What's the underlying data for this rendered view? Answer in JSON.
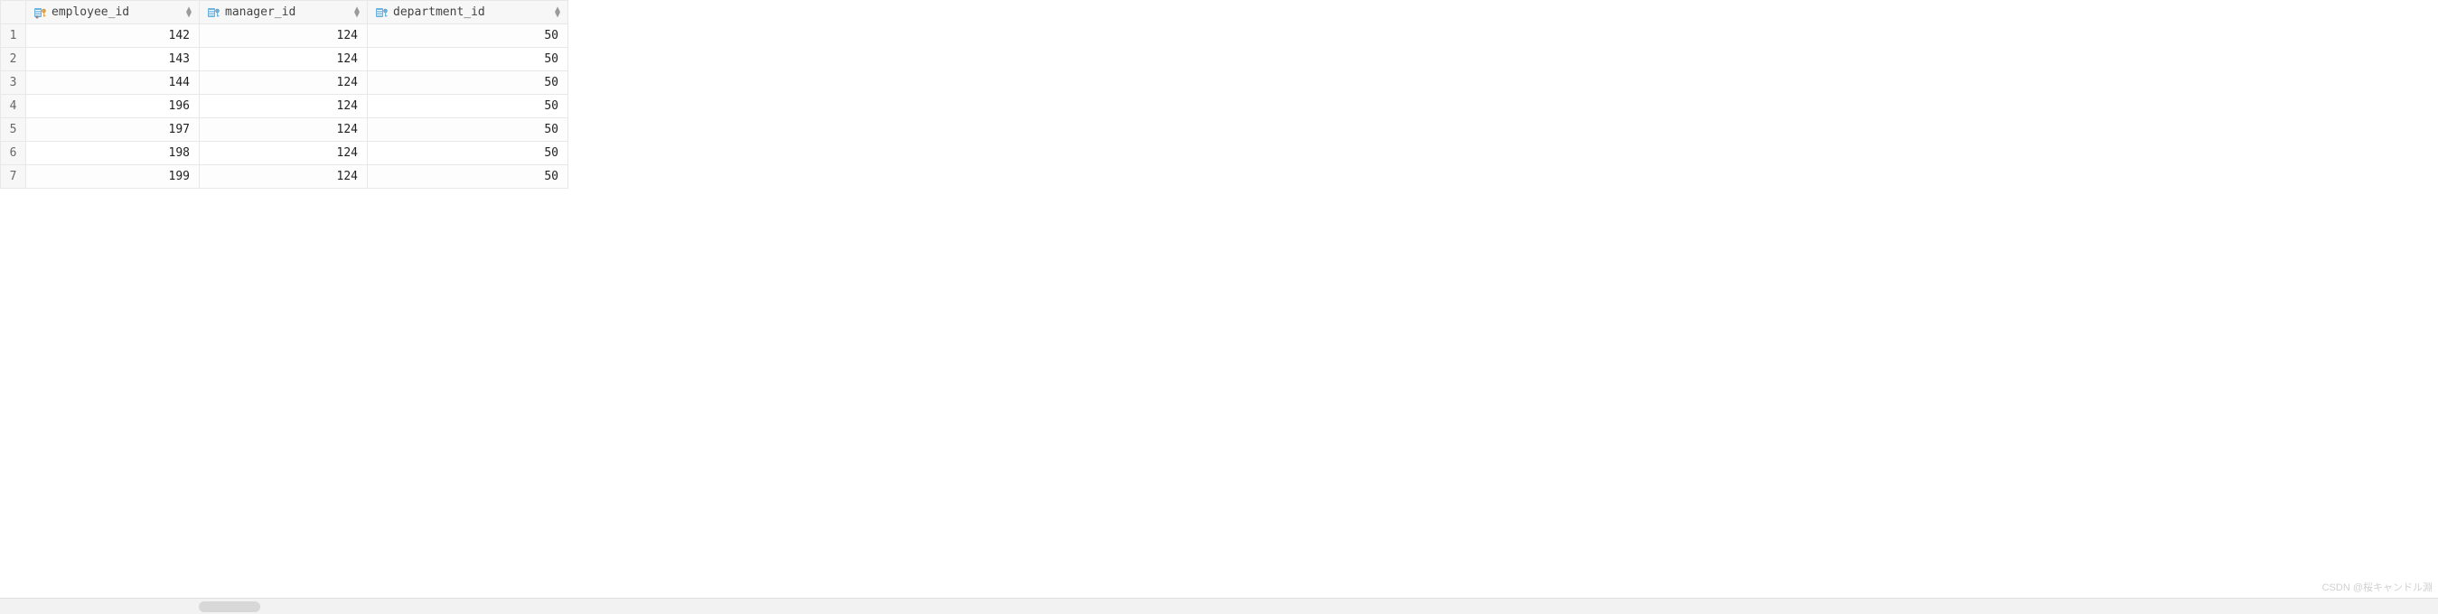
{
  "table": {
    "columns": [
      {
        "name": "employee_id",
        "icon_type": "pk"
      },
      {
        "name": "manager_id",
        "icon_type": "fk"
      },
      {
        "name": "department_id",
        "icon_type": "fk"
      }
    ],
    "rows": [
      {
        "num": "1",
        "employee_id": "142",
        "manager_id": "124",
        "department_id": "50"
      },
      {
        "num": "2",
        "employee_id": "143",
        "manager_id": "124",
        "department_id": "50"
      },
      {
        "num": "3",
        "employee_id": "144",
        "manager_id": "124",
        "department_id": "50"
      },
      {
        "num": "4",
        "employee_id": "196",
        "manager_id": "124",
        "department_id": "50"
      },
      {
        "num": "5",
        "employee_id": "197",
        "manager_id": "124",
        "department_id": "50"
      },
      {
        "num": "6",
        "employee_id": "198",
        "manager_id": "124",
        "department_id": "50"
      },
      {
        "num": "7",
        "employee_id": "199",
        "manager_id": "124",
        "department_id": "50"
      }
    ]
  },
  "watermark": "CSDN @桜キャンドル淵"
}
